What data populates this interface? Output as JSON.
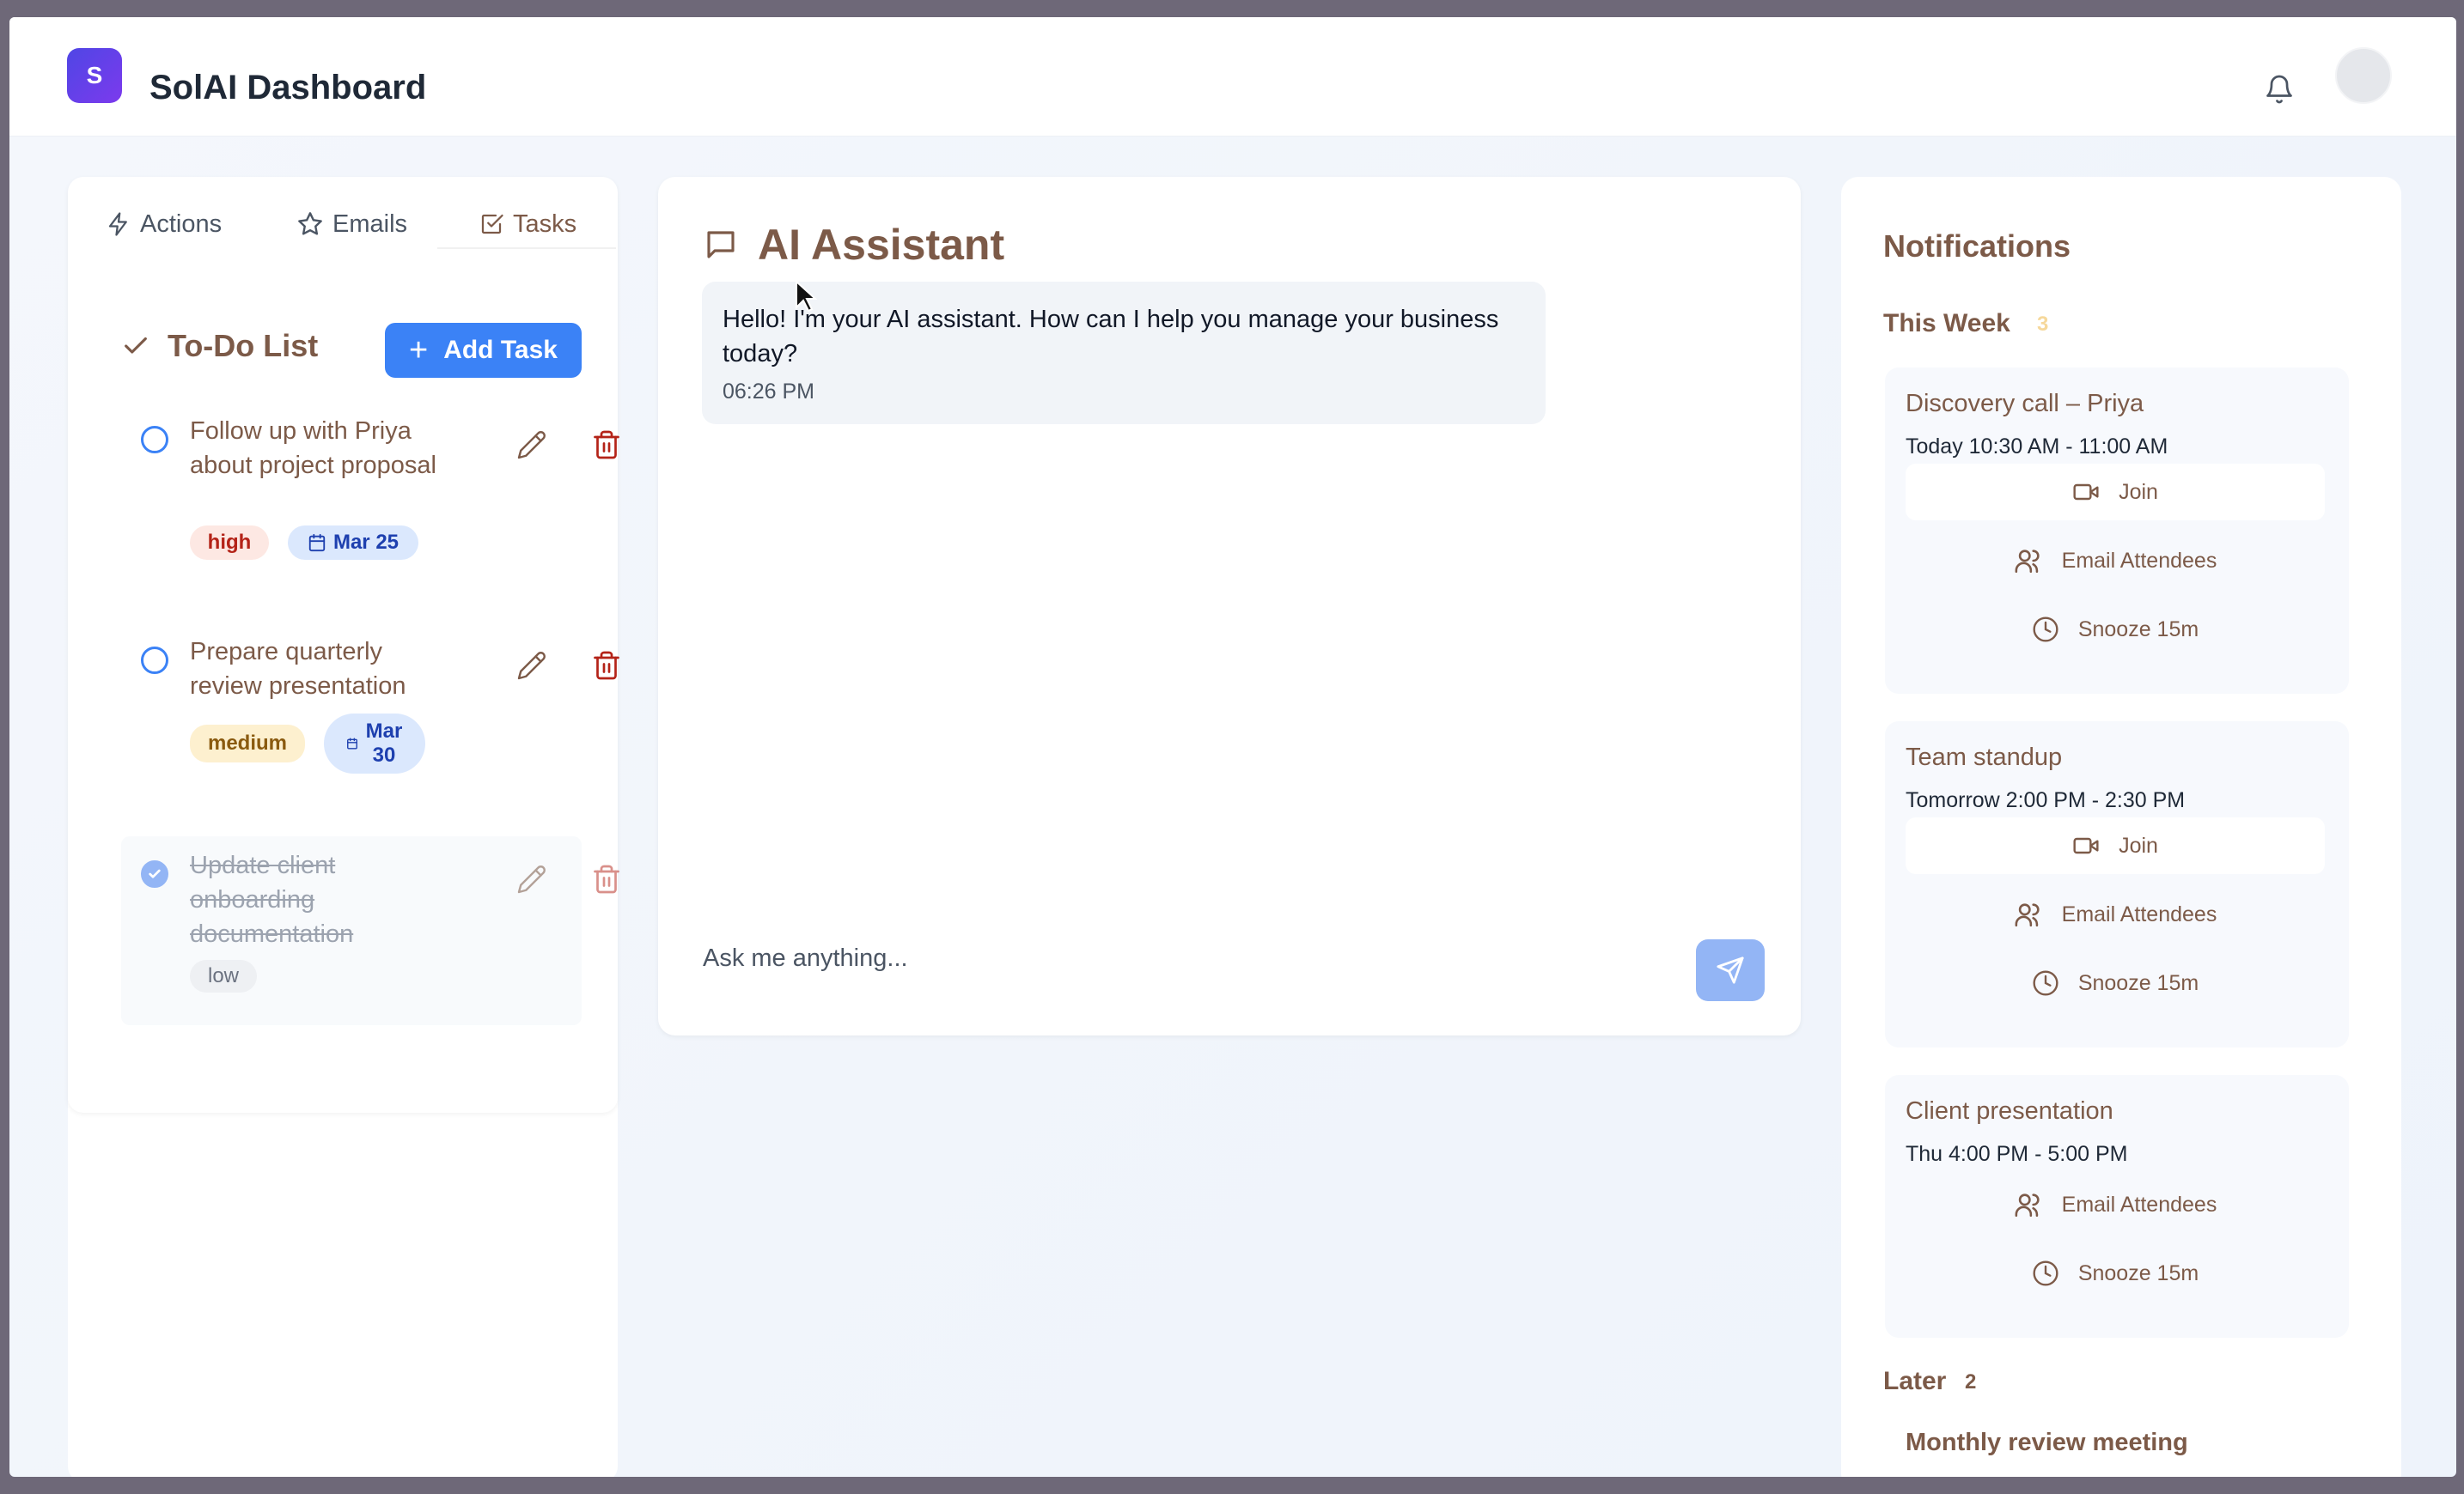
{
  "app": {
    "logo_letter": "S",
    "title": "SolAI Dashboard"
  },
  "tabs": [
    {
      "label": "Actions",
      "icon": "lightning-icon"
    },
    {
      "label": "Emails",
      "icon": "star-icon"
    },
    {
      "label": "Tasks",
      "icon": "checkbox-icon",
      "active": true
    }
  ],
  "todo": {
    "title": "To-Do List",
    "add_label": "Add Task",
    "tasks": [
      {
        "title": "Follow up with Priya about project proposal",
        "priority": "high",
        "date": "Mar 25",
        "done": false
      },
      {
        "title": "Prepare quarterly review presentation",
        "priority": "medium",
        "date": "Mar 30",
        "done": false
      },
      {
        "title": "Update client onboarding documentation",
        "priority": "low",
        "date": "",
        "done": true
      }
    ]
  },
  "assistant": {
    "title": "AI Assistant",
    "message": "Hello! I'm your AI assistant. How can I help you manage your business today?",
    "time": "06:26 PM",
    "placeholder": "Ask me anything..."
  },
  "notifications": {
    "title": "Notifications",
    "this_week": {
      "label": "This Week",
      "count": "3"
    },
    "events": [
      {
        "title": "Discovery call – Priya",
        "time": "Today 10:30 AM - 11:00 AM",
        "join": "Join",
        "email": "Email Attendees",
        "snooze": "Snooze 15m"
      },
      {
        "title": "Team standup",
        "time": "Tomorrow 2:00 PM - 2:30 PM",
        "join": "Join",
        "email": "Email Attendees",
        "snooze": "Snooze 15m"
      },
      {
        "title": "Client presentation",
        "time": "Thu 4:00 PM - 5:00 PM",
        "email": "Email Attendees",
        "snooze": "Snooze 15m"
      }
    ],
    "later": {
      "label": "Later",
      "count": "2"
    },
    "later_events": [
      {
        "title": "Monthly review meeting"
      }
    ]
  },
  "colors": {
    "accent": "#3b82f6",
    "brand_text": "#7c5a48",
    "high": "#b42318",
    "medium": "#8a5a0f",
    "delete": "#b42318"
  }
}
